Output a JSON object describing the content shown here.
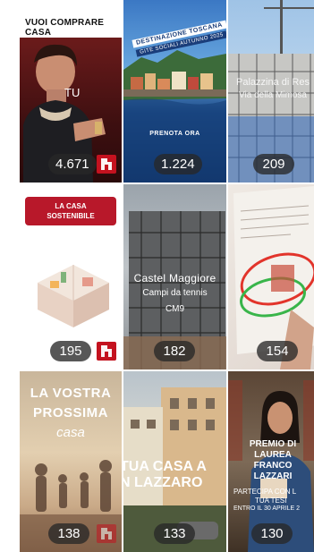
{
  "tiles": [
    {
      "overlay": "VUOI COMPRARE CASA",
      "caption": "TU",
      "count": "4.671"
    },
    {
      "overlay_line1": "DESTINAZIONE TOSCANA",
      "overlay_line2": "GITE SOCIALI AUTUNNO 2025",
      "cta": "PRENOTA ORA",
      "count": "1.224"
    },
    {
      "overlay_line1": "Palazzina di Res",
      "overlay_line2": "Via della Mimosa",
      "count": "209"
    },
    {
      "badge": "LA CASA SOSTENIBILE",
      "count": "195"
    },
    {
      "overlay_line1": "Castel Maggiore",
      "overlay_line2": "Campi da tennis",
      "overlay_line3": "CM9",
      "count": "182"
    },
    {
      "count": "154"
    },
    {
      "overlay_line1": "LA VOSTRA",
      "overlay_line2": "PROSSIMA",
      "overlay_line3": "casa",
      "count": "138"
    },
    {
      "overlay_line1": "TUA CASA A",
      "overlay_line2": "N LAZZARO",
      "count": "133"
    },
    {
      "overlay_line1": "PREMIO DI",
      "overlay_line2": "LAUREA",
      "overlay_line3": "FRANCO",
      "overlay_line4": "LAZZARI",
      "footer_line1": "PARTECIPA CON L",
      "footer_line2": "TUA TESI",
      "footer_line3": "ENTRO IL 30 APRILE 2",
      "count": "130"
    }
  ],
  "colors": {
    "brand_red": "#c4121f",
    "pill_bg": "#2a2a2a"
  }
}
